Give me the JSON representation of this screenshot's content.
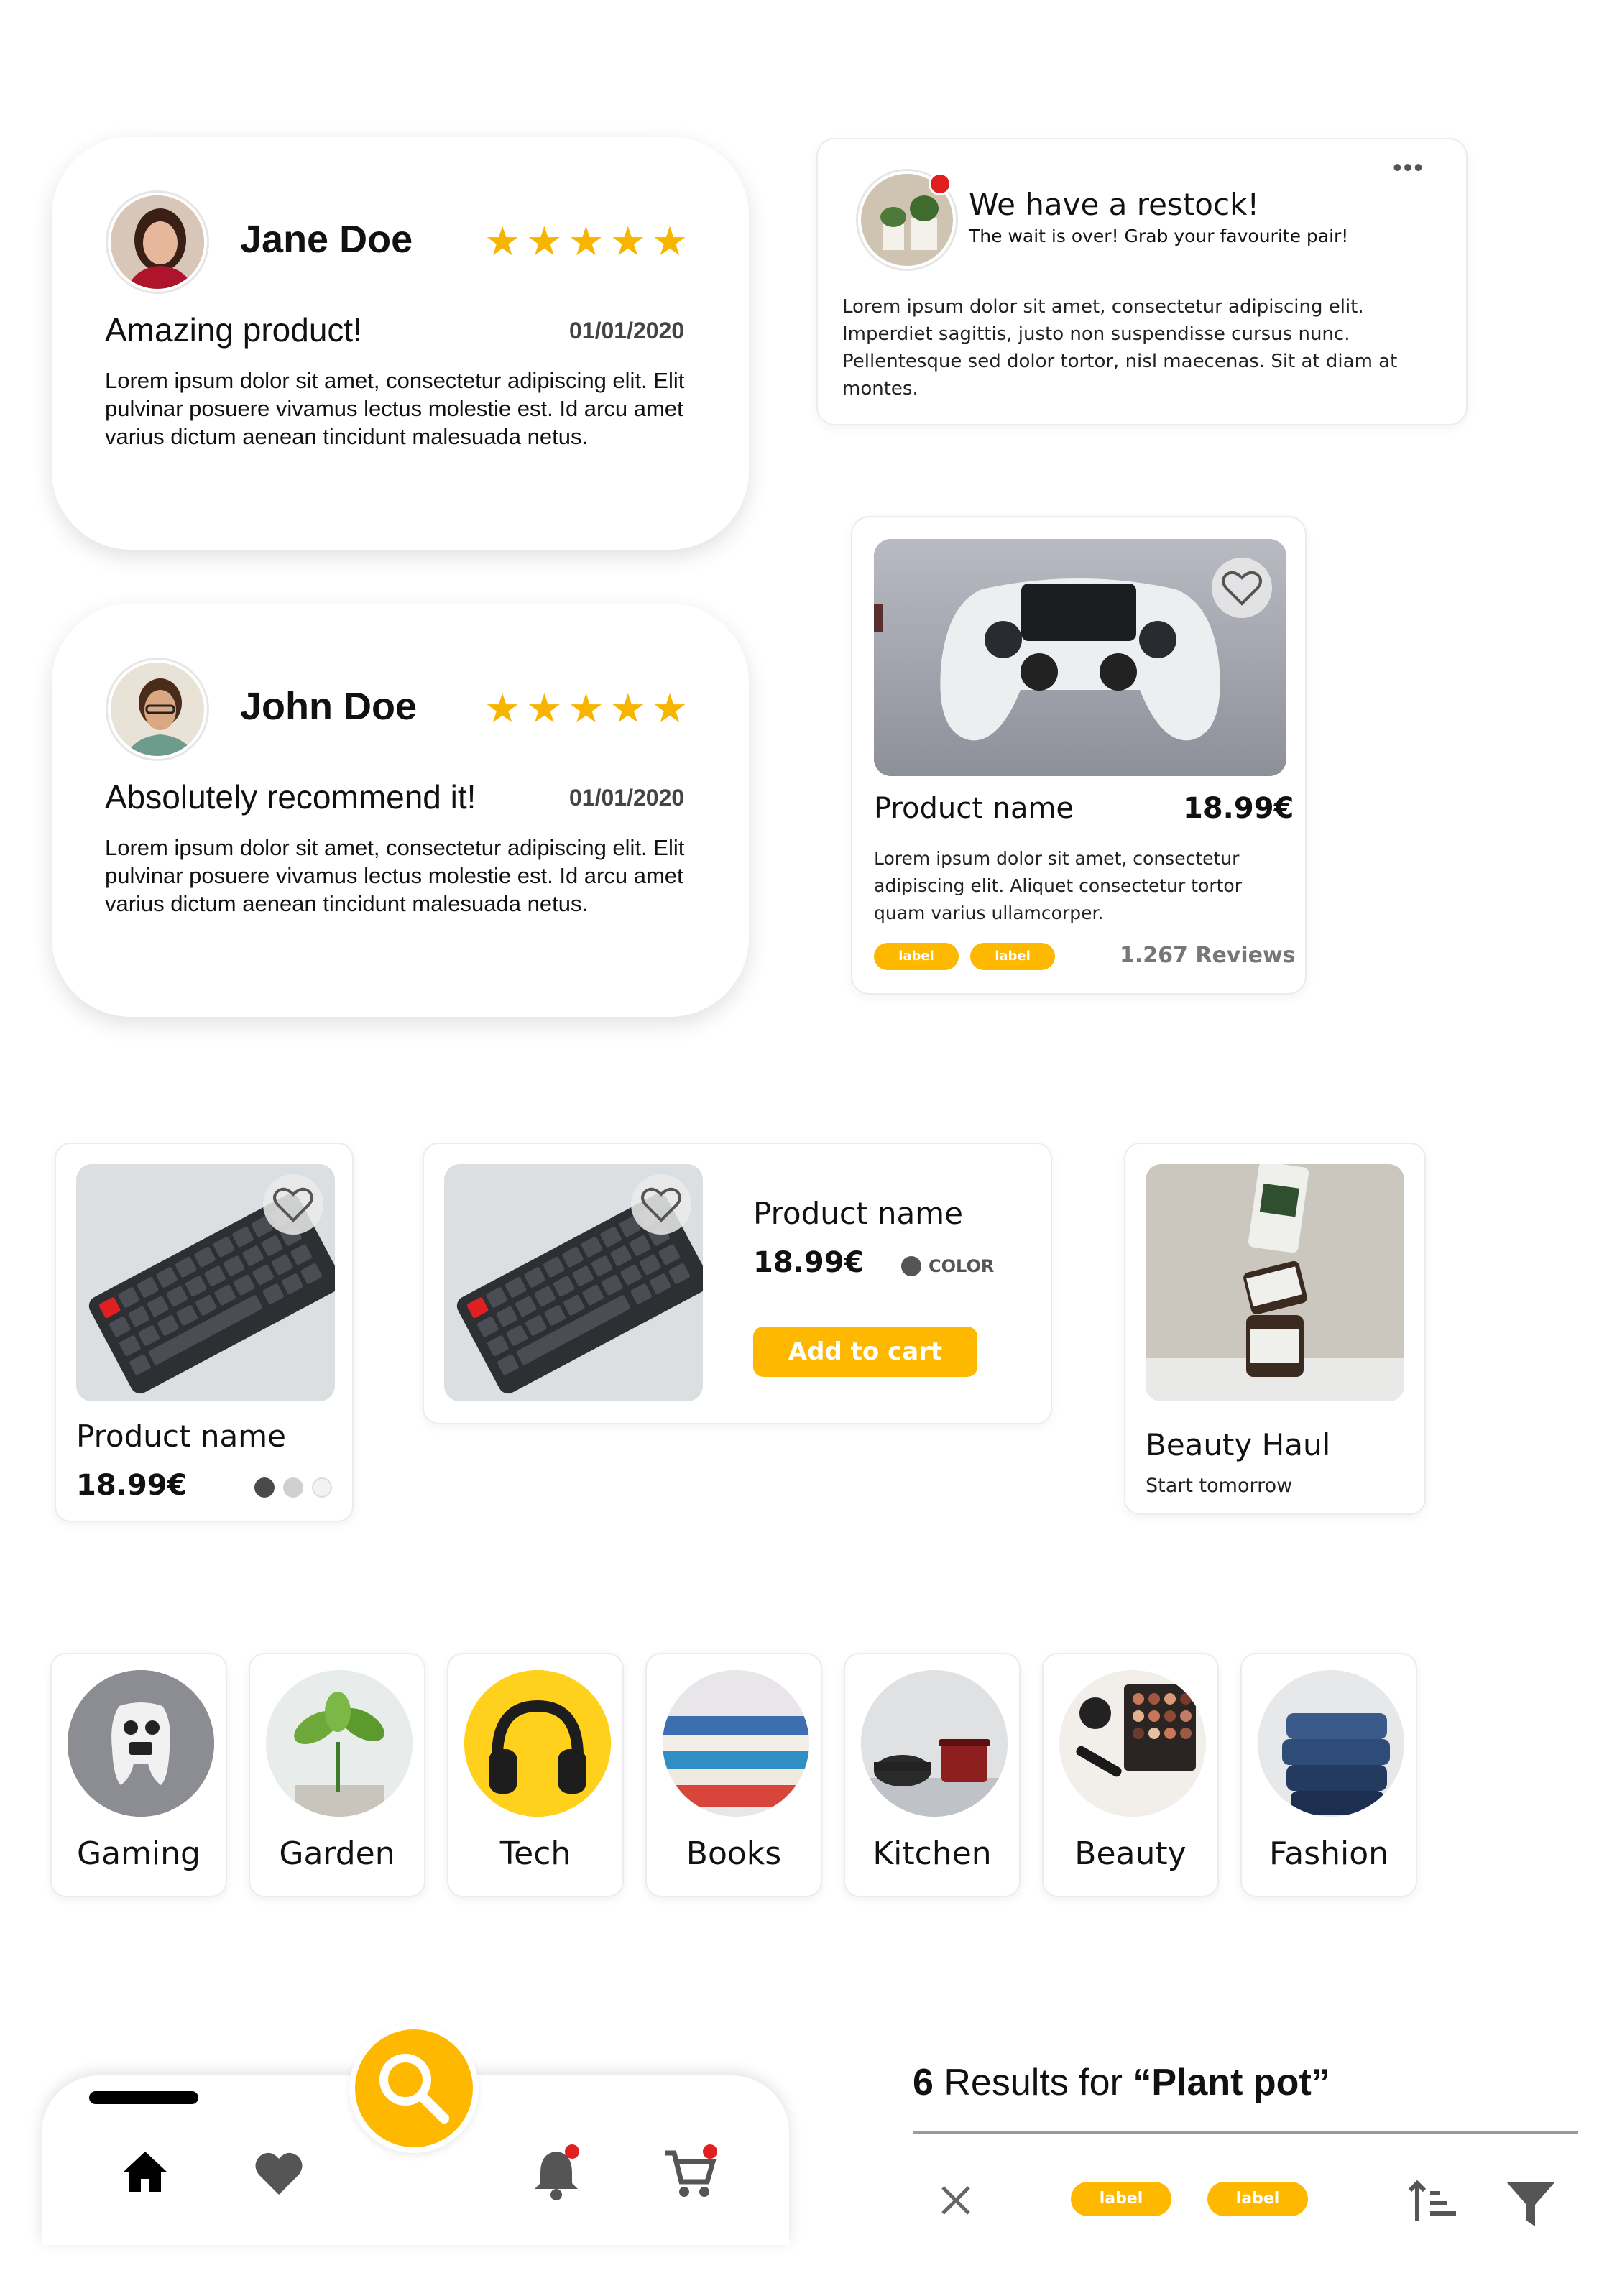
{
  "reviews": [
    {
      "name": "Jane Doe",
      "stars": "★★★★★",
      "title": "Amazing product!",
      "date": "01/01/2020",
      "text": "Lorem ipsum dolor sit amet, consectetur adipiscing elit. Elit pulvinar posuere vivamus lectus molestie est. Id arcu amet varius dictum aenean tincidunt malesuada netus."
    },
    {
      "name": "John Doe",
      "stars": "★★★★★",
      "title": "Absolutely recommend it!",
      "date": "01/01/2020",
      "text": "Lorem ipsum dolor sit amet, consectetur adipiscing elit. Elit pulvinar posuere vivamus lectus molestie est. Id arcu amet varius dictum aenean tincidunt malesuada netus."
    }
  ],
  "notification": {
    "title": "We have a restock!",
    "subtitle": "The wait is over! Grab your favourite pair!",
    "text": "Lorem ipsum dolor sit amet, consectetur adipiscing elit. Imperdiet sagittis, justo non suspendisse cursus nunc. Pellentesque sed dolor tortor, nisl maecenas. Sit at diam at montes.",
    "more": "•••"
  },
  "product_large": {
    "name": "Product name",
    "price": "18.99€",
    "text": "Lorem ipsum dolor sit amet, consectetur adipiscing elit. Aliquet consectetur tortor quam varius ullamcorper.",
    "labels": [
      "label",
      "label"
    ],
    "reviews": "1.267 Reviews"
  },
  "product_small": {
    "name": "Product name",
    "price": "18.99€"
  },
  "product_wide": {
    "name": "Product name",
    "price": "18.99€",
    "color_label": "COLOR",
    "cta": "Add to cart"
  },
  "event": {
    "title": "Beauty Haul",
    "subtitle": "Start tomorrow"
  },
  "categories": [
    "Gaming",
    "Garden",
    "Tech",
    "Books",
    "Kitchen",
    "Beauty",
    "Fashion"
  ],
  "results": {
    "count": "6",
    "text": " Results for ",
    "query": "“Plant pot”",
    "labels": [
      "label",
      "label"
    ]
  },
  "colors": {
    "accent": "#ffb800",
    "star": "#f7b500",
    "badge": "#e02020"
  },
  "icons": [
    "home-icon",
    "heart-icon",
    "search-icon",
    "bell-icon",
    "cart-icon",
    "close-icon",
    "sort-icon",
    "filter-icon"
  ]
}
